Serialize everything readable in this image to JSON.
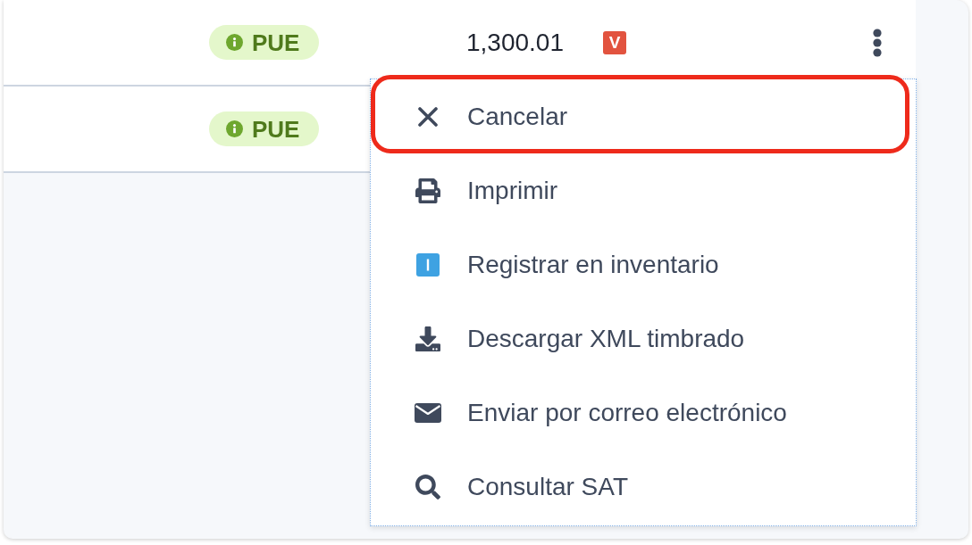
{
  "table": {
    "rows": [
      {
        "column_1": "PUE",
        "column_2": "1,300.01",
        "column_3": "V"
      },
      {
        "column_1": "PUE"
      }
    ]
  },
  "menu": {
    "items": [
      {
        "kind": "cancel",
        "label": "Cancelar",
        "highlighted": true
      },
      {
        "kind": "print",
        "label": "Imprimir",
        "highlighted": false
      },
      {
        "kind": "inventory",
        "label": "Registrar en inventario",
        "highlighted": false
      },
      {
        "kind": "download",
        "label": "Descargar XML timbrado",
        "highlighted": false
      },
      {
        "kind": "email",
        "label": "Enviar por correo electrónico",
        "highlighted": false
      },
      {
        "kind": "search",
        "label": "Consultar SAT",
        "highlighted": false
      }
    ]
  }
}
